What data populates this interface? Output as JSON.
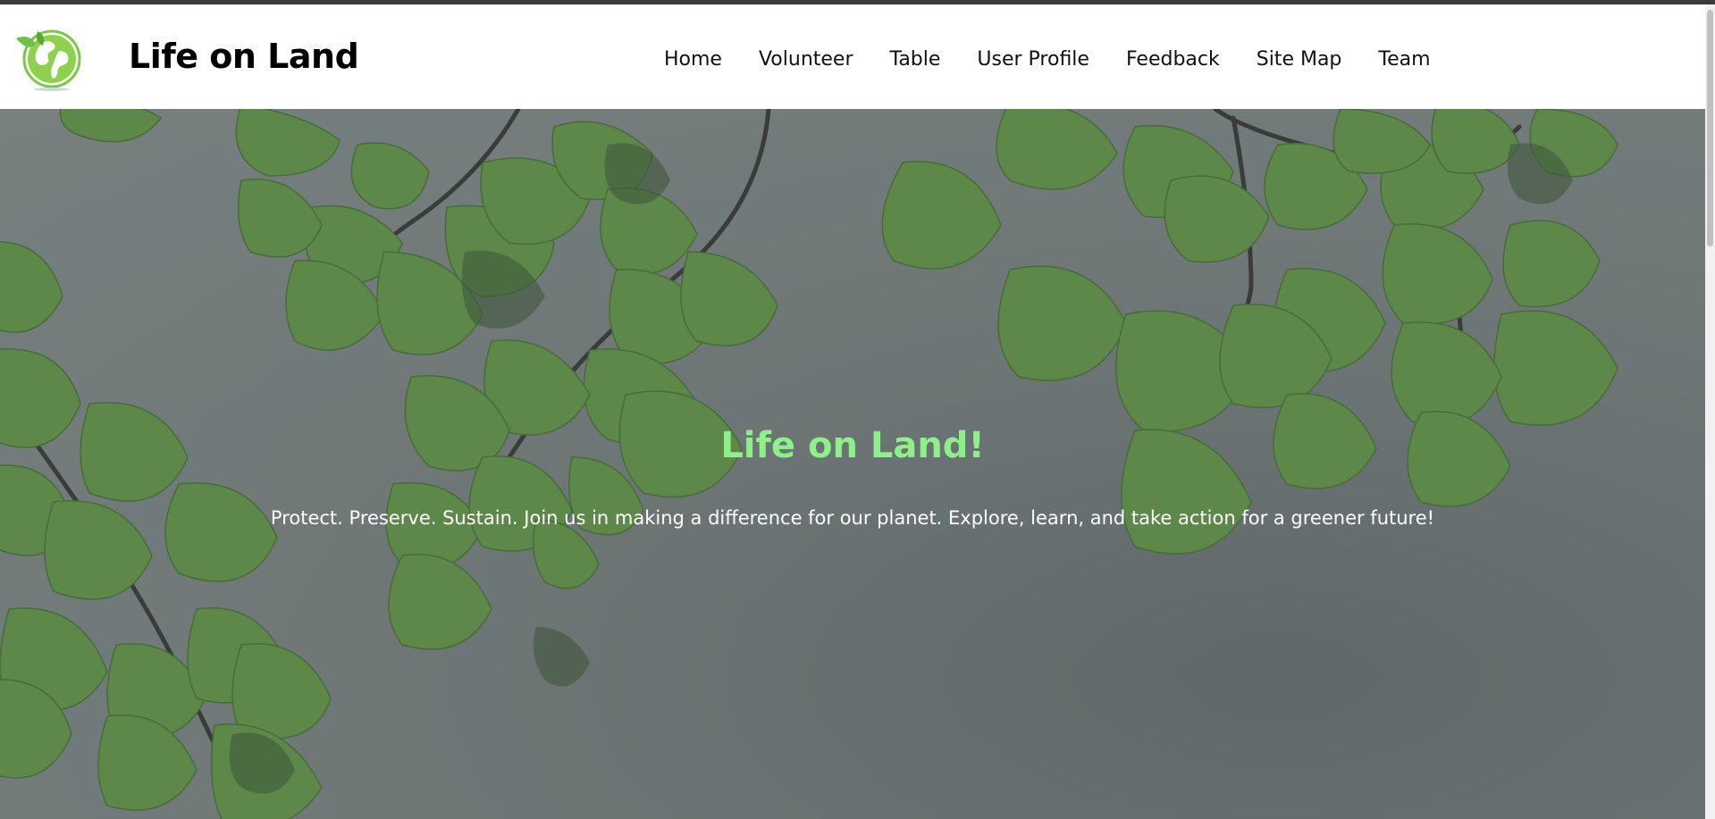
{
  "header": {
    "brand": "Life on Land",
    "logo_icon": "globe-leaf-icon"
  },
  "nav": {
    "items": [
      {
        "label": "Home"
      },
      {
        "label": "Volunteer"
      },
      {
        "label": "Table"
      },
      {
        "label": "User Profile"
      },
      {
        "label": "Feedback"
      },
      {
        "label": "Site Map"
      },
      {
        "label": "Team"
      }
    ]
  },
  "hero": {
    "title": "Life on Land!",
    "subtitle": "Protect. Preserve. Sustain. Join us in making a difference for our planet. Explore, learn, and take action for a greener future!"
  },
  "colors": {
    "accent_title": "#8ef08a",
    "logo_green": "#6cc04a",
    "overlay": "#6e7676"
  }
}
